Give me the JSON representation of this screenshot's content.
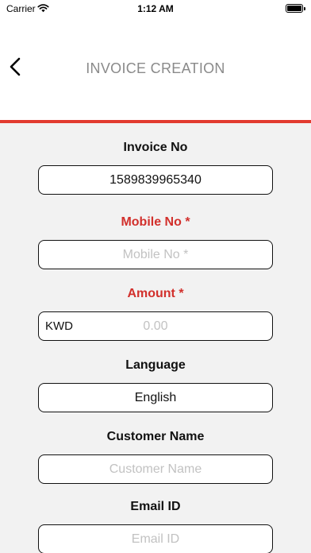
{
  "status_bar": {
    "carrier": "Carrier",
    "time": "1:12 AM"
  },
  "nav": {
    "title": "INVOICE CREATION",
    "back_icon": "chevron-left-icon"
  },
  "colors": {
    "accent_red": "#e23b2f",
    "required_label": "#d2302c",
    "title_gray": "#8a8a8a"
  },
  "form": {
    "invoice_no": {
      "label": "Invoice No",
      "value": "1589839965340"
    },
    "mobile_no": {
      "label": "Mobile No *",
      "placeholder": "Mobile No *"
    },
    "amount": {
      "label": "Amount *",
      "currency": "KWD",
      "placeholder": "0.00"
    },
    "language": {
      "label": "Language",
      "value": "English"
    },
    "customer_name": {
      "label": "Customer Name",
      "placeholder": "Customer Name"
    },
    "email": {
      "label": "Email ID",
      "placeholder": "Email ID"
    }
  }
}
